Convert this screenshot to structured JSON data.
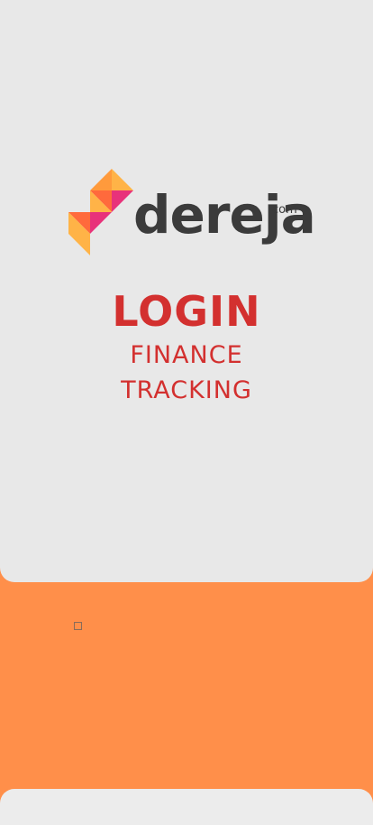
{
  "logo": {
    "word": "dereja",
    "suffix": "com"
  },
  "login": {
    "title": "LOGIN",
    "subtitle_line1": "FINANCE",
    "subtitle_line2": "TRACKING"
  },
  "colors": {
    "accent": "#d3302f",
    "orange": "#ff8f4a",
    "card": "#e8e8e8"
  }
}
